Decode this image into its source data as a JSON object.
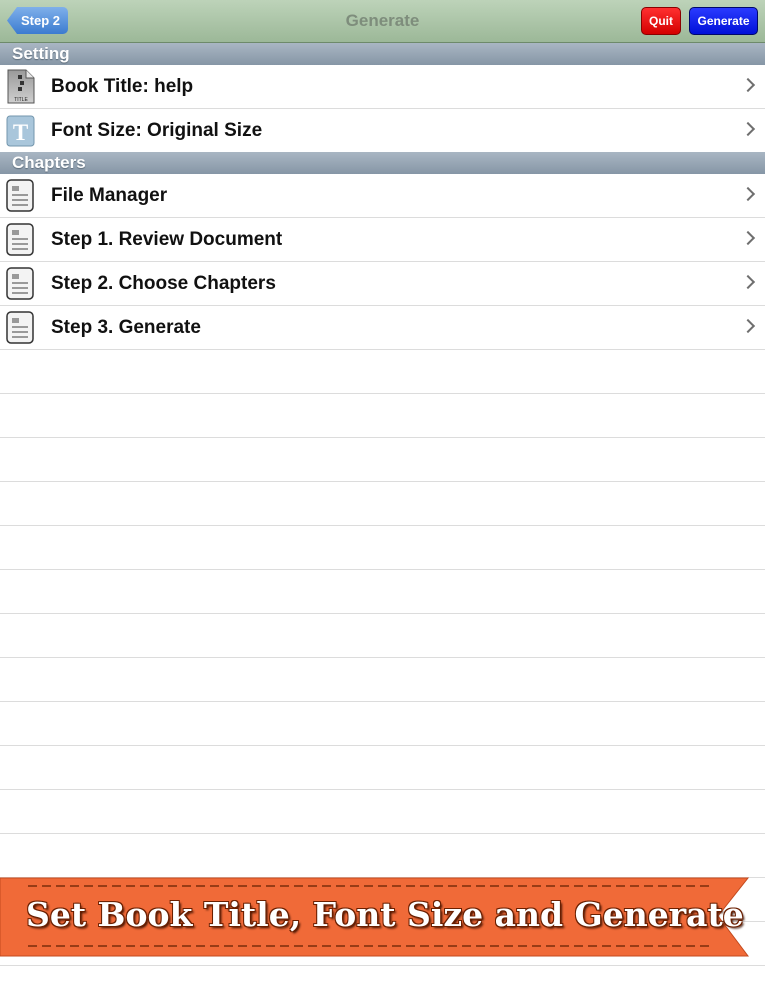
{
  "navbar": {
    "back_label": "Step 2",
    "title": "Generate",
    "quit_label": "Quit",
    "generate_label": "Generate"
  },
  "sections": [
    {
      "header": "Setting",
      "rows": [
        {
          "label": "Book Title: help",
          "icon": "title-document-icon"
        },
        {
          "label": "Font Size: Original Size",
          "icon": "font-t-icon"
        }
      ]
    },
    {
      "header": "Chapters",
      "rows": [
        {
          "label": "File Manager",
          "icon": "document-icon"
        },
        {
          "label": "Step 1. Review Document",
          "icon": "document-icon"
        },
        {
          "label": "Step 2. Choose Chapters",
          "icon": "document-icon"
        },
        {
          "label": "Step 3. Generate",
          "icon": "document-icon"
        }
      ]
    }
  ],
  "banner": {
    "text": "Set Book Title, Font Size and Generate",
    "color": "#f06a38"
  },
  "colors": {
    "navbar": "#a9c3a6",
    "quit": "#e80000",
    "generate": "#0a1fe8",
    "back": "#4a88d8",
    "section_header": "#97a6b5"
  }
}
